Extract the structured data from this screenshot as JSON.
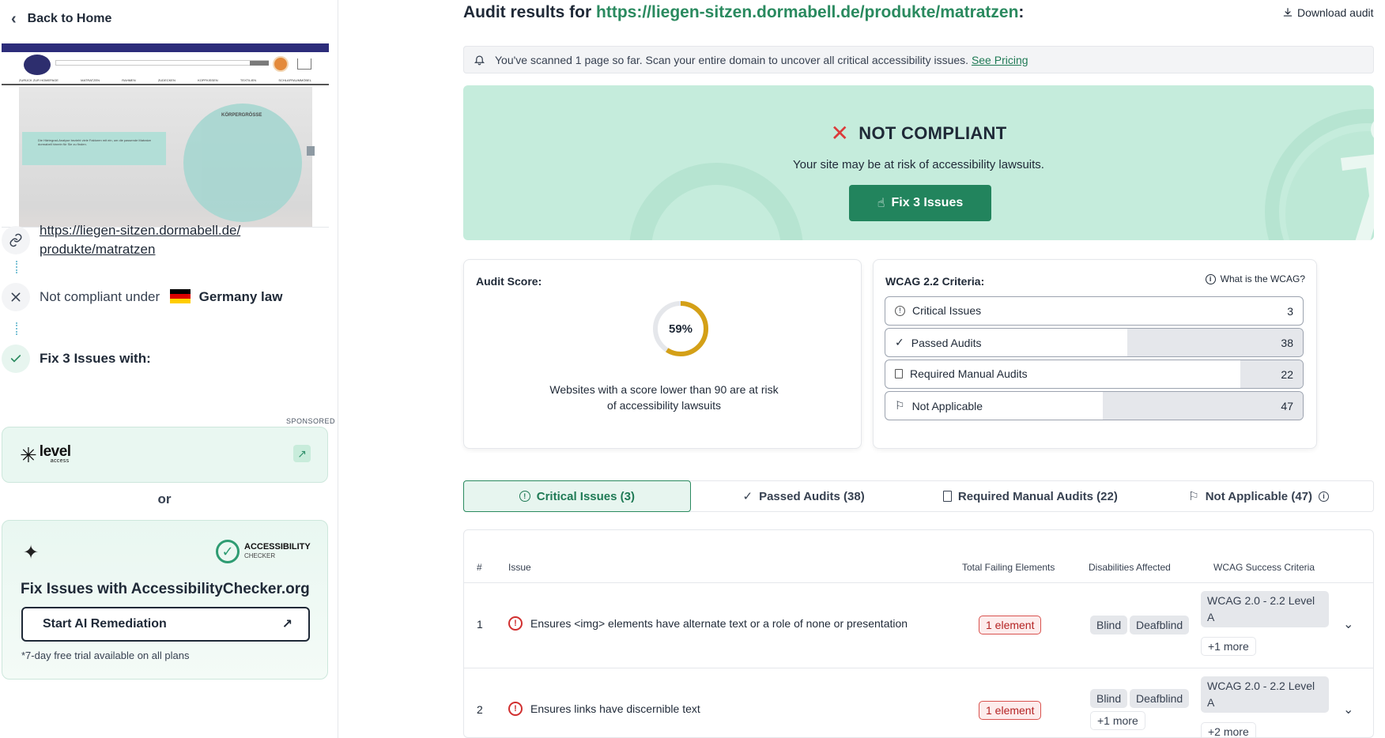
{
  "sidebar": {
    "back_label": "Back to Home",
    "preview": {
      "nav_items": [
        "ZURÜCK ZUR HOMEPAGE",
        "MATRATZEN",
        "RAHMEN",
        "ZUDECKEN",
        "KOPFKISSEN",
        "TEXTILIEN",
        "SCHLAFRAUMMÖBEL"
      ],
      "circle_title": "KÖRPERGRÖSSE",
      "box_text": "Die Härtegrad-Analyse bezieht viele Faktoren mit ein, um die passende Matratze dormabell hinrein für Sie zu finden."
    },
    "url_line1": "https://liegen-sitzen.dormabell.de/",
    "url_line2": "produkte/matratzen",
    "not_compliant_prefix": "Not compliant under",
    "law_label": "Germany law",
    "fix_title": "Fix 3 Issues with:",
    "sponsored_label": "SPONSORED",
    "level_access": {
      "brand": "level",
      "sub": "access"
    },
    "or_label": "or",
    "ac_brand_line1": "ACCESSIBILITY",
    "ac_brand_line2": "CHECKER",
    "ac_title": "Fix Issues with AccessibilityChecker.org",
    "ac_button": "Start AI Remediation",
    "ac_note": "*7-day free trial available on all plans"
  },
  "header": {
    "title_prefix": "Audit results for ",
    "title_url": "https://liegen-sitzen.dormabell.de/produkte/matratzen",
    "title_suffix": ":",
    "download_label": "Download audit"
  },
  "banner": {
    "text": "You've scanned 1 page so far. Scan your entire domain to uncover all critical accessibility issues.",
    "link": "See Pricing"
  },
  "status": {
    "heading": "NOT COMPLIANT",
    "subtitle": "Your site may be at risk of accessibility lawsuits.",
    "fix_button": "Fix 3 Issues"
  },
  "score": {
    "title": "Audit Score:",
    "value": 59,
    "label": "59%",
    "note_line1": "Websites with a score lower than 90 are at risk",
    "note_line2": "of accessibility lawsuits"
  },
  "wcag": {
    "title": "WCAG 2.2 Criteria:",
    "help": "What is the WCAG?",
    "rows": [
      {
        "label": "Critical Issues",
        "value": "3",
        "fraction": 0
      },
      {
        "label": "Passed Audits",
        "value": "38",
        "fraction": 0.42
      },
      {
        "label": "Required Manual Audits",
        "value": "22",
        "fraction": 0.15
      },
      {
        "label": "Not Applicable",
        "value": "47",
        "fraction": 0.48
      }
    ]
  },
  "tabs": [
    "Critical Issues (3)",
    "Passed Audits (38)",
    "Required Manual Audits (22)",
    "Not Applicable (47)"
  ],
  "table": {
    "headers": [
      "#",
      "Issue",
      "Total Failing Elements",
      "Disabilities Affected",
      "WCAG Success Criteria"
    ],
    "rows": [
      {
        "index": "1",
        "issue": "Ensures <img> elements have alternate text or a role of none or presentation",
        "failing": "1 element",
        "disabilities": [
          "Blind",
          "Deafblind"
        ],
        "wcag": "WCAG 2.0 - 2.2 Level A",
        "wcag_more": "+1 more"
      },
      {
        "index": "2",
        "issue": "Ensures links have discernible text",
        "failing": "1 element",
        "disabilities": [
          "Blind",
          "Deafblind"
        ],
        "disabilities_more": "+1 more",
        "wcag": "WCAG 2.0 - 2.2 Level A",
        "wcag_more": "+2 more"
      }
    ]
  },
  "colors": {
    "accent": "#22845d",
    "status_bg": "#c5ecdc",
    "score_ring": "#d4a017",
    "danger": "#d12f2f"
  }
}
